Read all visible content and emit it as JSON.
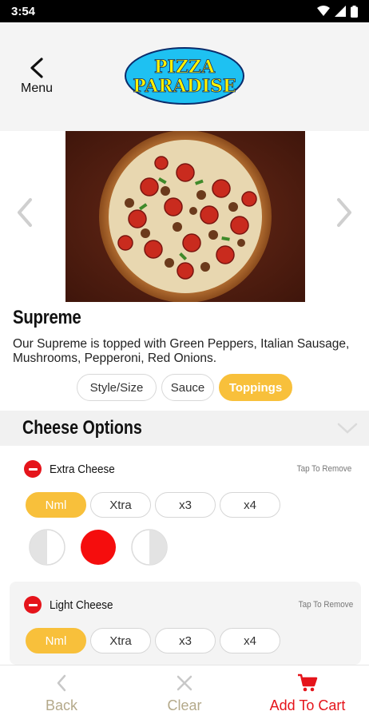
{
  "status": {
    "time": "3:54"
  },
  "header": {
    "back_label": "Menu",
    "logo_line1": "PIZZA",
    "logo_line2": "PARADISE"
  },
  "item": {
    "title": "Supreme",
    "description": "Our Supreme is topped with Green Peppers, Italian Sausage, Mushrooms, Pepperoni, Red Onions."
  },
  "tabs": [
    {
      "label": "Style/Size",
      "active": false
    },
    {
      "label": "Sauce",
      "active": false
    },
    {
      "label": "Toppings",
      "active": true
    }
  ],
  "section": {
    "title": "Cheese Options"
  },
  "options": [
    {
      "name": "Extra Cheese",
      "remove_label": "Tap To Remove",
      "amounts": [
        "Nml",
        "Xtra",
        "x3",
        "x4"
      ],
      "selected_amount": "Nml",
      "portions": [
        "left-half",
        "whole",
        "right-half"
      ],
      "selected_portion": "whole"
    },
    {
      "name": "Light Cheese",
      "remove_label": "Tap To Remove",
      "amounts": [
        "Nml",
        "Xtra",
        "x3",
        "x4"
      ],
      "selected_amount": "Nml"
    }
  ],
  "bottom": {
    "back": "Back",
    "clear": "Clear",
    "add": "Add To Cart"
  },
  "colors": {
    "accent": "#f8c03b",
    "red": "#e5141b",
    "logo_blue": "#1ec1f2",
    "logo_yellow": "#fff200"
  }
}
